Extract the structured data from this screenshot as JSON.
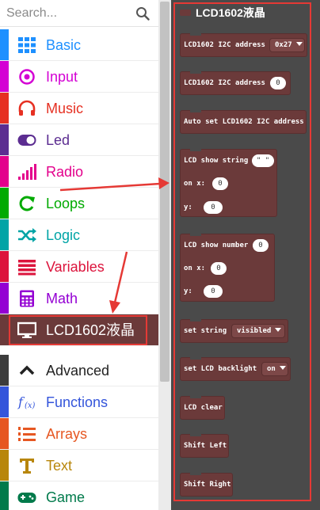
{
  "search": {
    "placeholder": "Search..."
  },
  "categories": [
    {
      "label": "Basic",
      "color": "#1e90ff",
      "icon": "grid-icon"
    },
    {
      "label": "Input",
      "color": "#d400d4",
      "icon": "target-icon"
    },
    {
      "label": "Music",
      "color": "#e63022",
      "icon": "headphones-icon"
    },
    {
      "label": "Led",
      "color": "#5c2d91",
      "icon": "toggle-icon"
    },
    {
      "label": "Radio",
      "color": "#e3008c",
      "icon": "signal-icon"
    },
    {
      "label": "Loops",
      "color": "#00aa00",
      "icon": "loop-icon"
    },
    {
      "label": "Logic",
      "color": "#00a4a6",
      "icon": "shuffle-icon"
    },
    {
      "label": "Variables",
      "color": "#dc143c",
      "icon": "list-icon"
    },
    {
      "label": "Math",
      "color": "#9400d3",
      "icon": "calculator-icon"
    },
    {
      "label": "LCD1602液晶",
      "color": "#6b3a3a",
      "icon": "monitor-icon"
    },
    {
      "label": "Advanced",
      "color": "#3c3c3c",
      "icon": "chevron-up-icon"
    },
    {
      "label": "Functions",
      "color": "#3455db",
      "icon": "function-icon"
    },
    {
      "label": "Arrays",
      "color": "#e65722",
      "icon": "numbered-list-icon"
    },
    {
      "label": "Text",
      "color": "#b8860b",
      "icon": "text-icon"
    },
    {
      "label": "Game",
      "color": "#007a4b",
      "icon": "gamepad-icon"
    }
  ],
  "flyout": {
    "title": "LCD1602液晶",
    "blocks": [
      {
        "text": "LCD1602 I2C address",
        "dropdown": "0x27"
      },
      {
        "text": "LCD1602 I2C address",
        "value": "0"
      },
      {
        "text": "Auto set LCD1602 I2C address"
      },
      {
        "text": "LCD show string",
        "value": "\" \"",
        "x_label": "on x:",
        "x_value": "0",
        "y_label": "y:",
        "y_value": "0"
      },
      {
        "text": "LCD show number",
        "value": "0",
        "x_label": "on x:",
        "x_value": "0",
        "y_label": "y:",
        "y_value": "0"
      },
      {
        "text": "set string",
        "dropdown": "visibled"
      },
      {
        "text": "set LCD backlight",
        "dropdown": "on"
      },
      {
        "text": "LCD clear"
      },
      {
        "text": "Shift Left"
      },
      {
        "text": "Shift Right"
      }
    ]
  },
  "colors": {
    "block": "#6b3a3a",
    "flyout_bg": "#4a4a4a",
    "annotation": "#e53935"
  }
}
